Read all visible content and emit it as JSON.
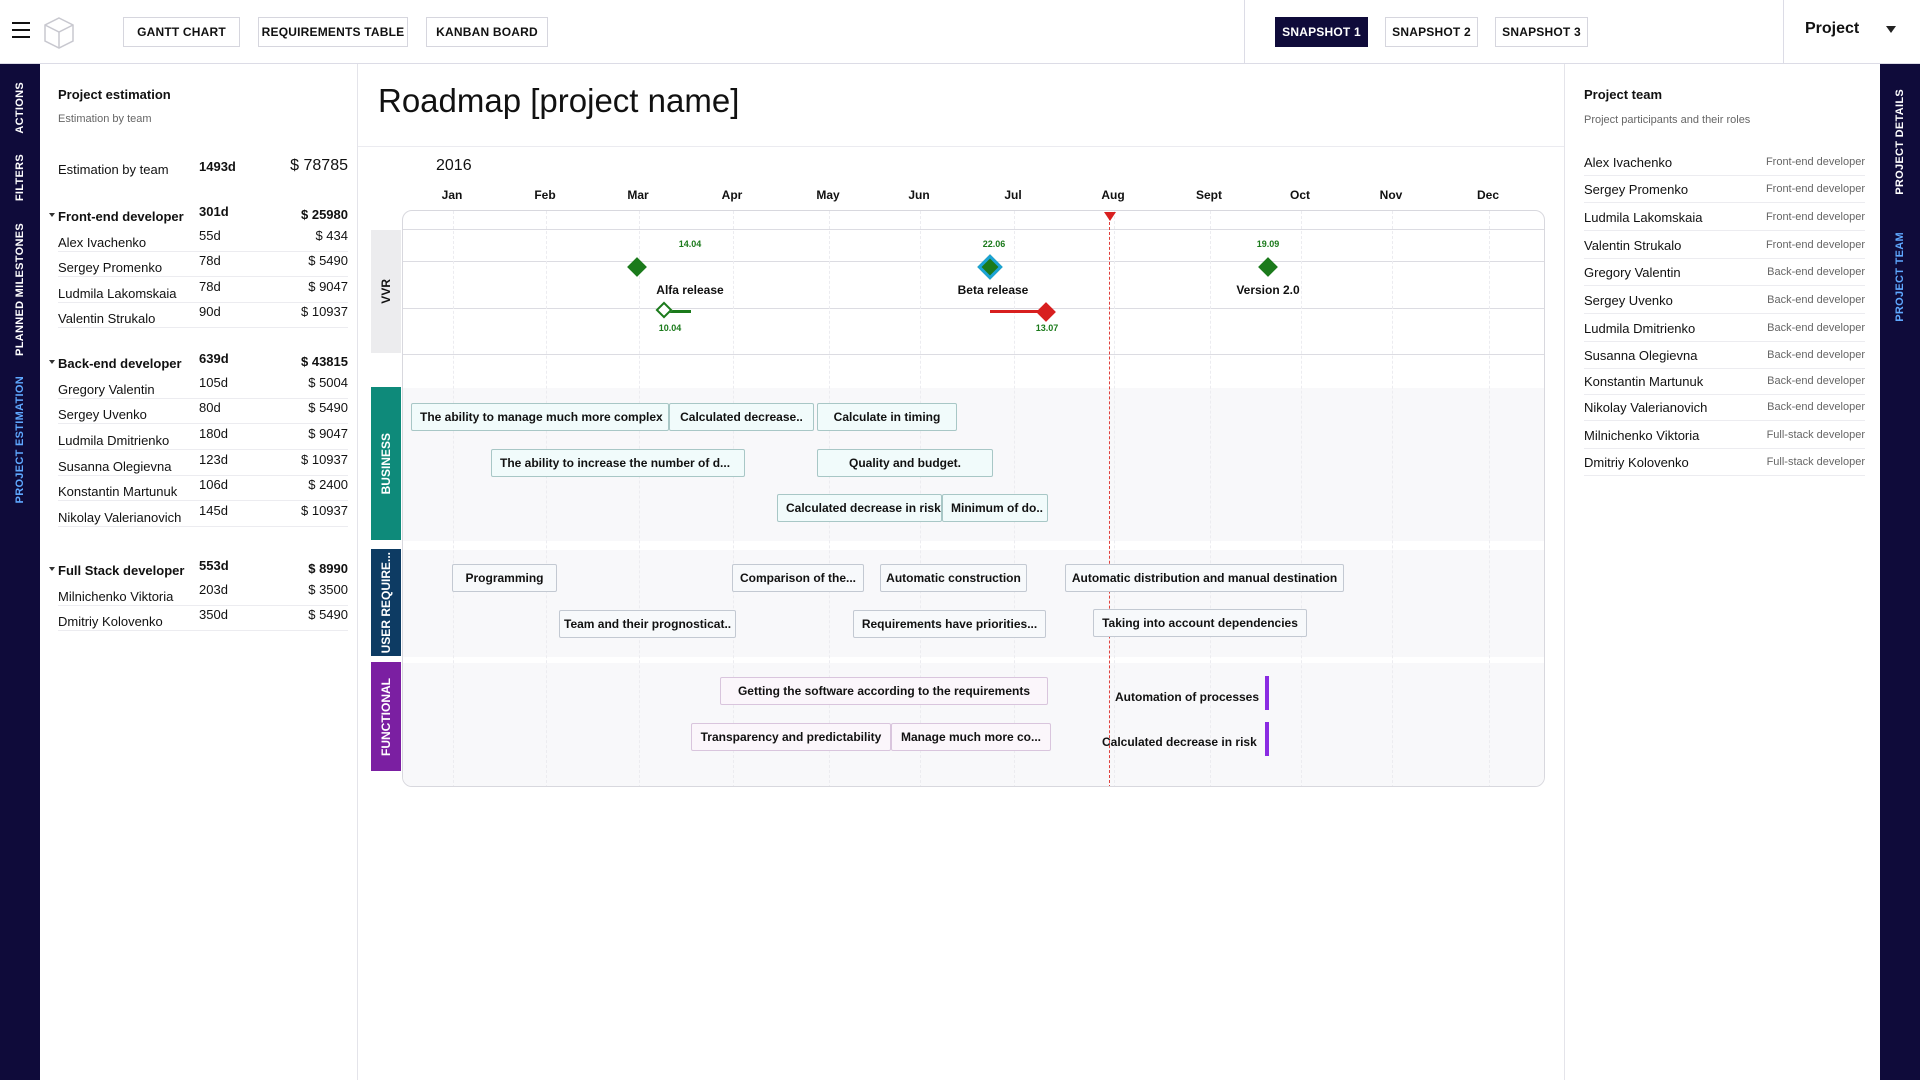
{
  "topbar": {
    "views": [
      "GANTT CHART",
      "REQUIREMENTS TABLE",
      "KANBAN BOARD"
    ],
    "snapshots": [
      "SNAPSHOT  1",
      "SNAPSHOT  2",
      "SNAPSHOT  3"
    ],
    "active_snapshot": 0,
    "project_select": "Project"
  },
  "left_rail": [
    "ACTIONS",
    "FILTERS",
    "PLANNED MILESTONES",
    "PROJECT ESTIMATION"
  ],
  "right_rail": [
    "PROJECT DETAILS",
    "PROJECT TEAM"
  ],
  "estimation": {
    "title": "Project estimation",
    "subtitle": "Estimation by team",
    "total": {
      "label": "Estimation by team",
      "days": "1493d",
      "cost": "$ 78785"
    },
    "groups": [
      {
        "role": "Front-end developer",
        "days": "301d",
        "cost": "$ 25980",
        "members": [
          {
            "name": "Alex Ivachenko",
            "days": "55d",
            "cost": "$ 434"
          },
          {
            "name": "Sergey Promenko",
            "days": "78d",
            "cost": "$ 5490"
          },
          {
            "name": "Ludmila Lakomskaia",
            "days": "78d",
            "cost": "$ 9047"
          },
          {
            "name": "Valentin Strukalo",
            "days": "90d",
            "cost": "$ 10937"
          }
        ]
      },
      {
        "role": "Back-end developer",
        "days": "639d",
        "cost": "$ 43815",
        "members": [
          {
            "name": "Gregory Valentin",
            "days": "105d",
            "cost": "$ 5004"
          },
          {
            "name": "Sergey Uvenko",
            "days": "80d",
            "cost": "$ 5490"
          },
          {
            "name": "Ludmila Dmitrienko",
            "days": "180d",
            "cost": "$ 9047"
          },
          {
            "name": "Susanna Olegievna",
            "days": "123d",
            "cost": "$ 10937"
          },
          {
            "name": "Konstantin Martunuk",
            "days": "106d",
            "cost": "$ 2400"
          },
          {
            "name": "Nikolay Valerianovich",
            "days": "145d",
            "cost": "$ 10937"
          }
        ]
      },
      {
        "role": "Full Stack developer",
        "days": "553d",
        "cost": "$ 8990",
        "members": [
          {
            "name": "Milnichenko Viktoria",
            "days": "203d",
            "cost": "$ 3500"
          },
          {
            "name": "Dmitriy Kolovenko",
            "days": "350d",
            "cost": "$ 5490"
          }
        ]
      }
    ]
  },
  "roadmap": {
    "title": "Roadmap [project name]",
    "year": "2016",
    "months": [
      "Jan",
      "Feb",
      "Mar",
      "Apr",
      "May",
      "Jun",
      "Jul",
      "Aug",
      "Sept",
      "Oct",
      "Nov",
      "Dec"
    ],
    "lanes": {
      "vvr": "VVR",
      "business": "BUSINESS",
      "user_req": "USER REQUIRE...",
      "functional": "FUNCTIONAL"
    },
    "milestones": [
      {
        "name": "Alfa release",
        "planned": "14.04",
        "actual": "10.04"
      },
      {
        "name": "Beta release",
        "planned": "22.06",
        "actual": "13.07"
      },
      {
        "name": "Version 2.0",
        "planned": "19.09"
      }
    ],
    "business_tasks": [
      "The ability to manage much more complex",
      "Calculated decrease..",
      "Calculate in timing",
      "The ability to increase the number of d...",
      "Quality and budget.",
      "Calculated decrease in risk",
      "Minimum of do.."
    ],
    "userreq_tasks": [
      "Programming",
      "Comparison of the...",
      "Automatic construction",
      "Automatic distribution and manual destination",
      "Team and their prognosticat..",
      "Requirements have priorities...",
      "Taking into account dependencies"
    ],
    "functional_tasks": [
      "Getting the software according to the requirements",
      "Automation of processes",
      "Transparency and predictability",
      "Manage much more co...",
      "Calculated decrease in risk"
    ],
    "colors": {
      "milestone_green": "#1b7a1b",
      "late_red": "#d81f1f",
      "business": "#0e8a7a",
      "user_req": "#0d3b63",
      "functional": "#7b1fa2"
    }
  },
  "team": {
    "title": "Project team",
    "subtitle": "Project participants and their roles",
    "members": [
      {
        "name": "Alex Ivachenko",
        "role": "Front-end developer"
      },
      {
        "name": "Sergey Promenko",
        "role": "Front-end developer"
      },
      {
        "name": "Ludmila Lakomskaia",
        "role": "Front-end developer"
      },
      {
        "name": "Valentin Strukalo",
        "role": "Front-end developer"
      },
      {
        "name": "Gregory Valentin",
        "role": "Back-end developer"
      },
      {
        "name": "Sergey Uvenko",
        "role": "Back-end developer"
      },
      {
        "name": "Ludmila Dmitrienko",
        "role": "Back-end developer"
      },
      {
        "name": "Susanna Olegievna",
        "role": "Back-end developer"
      },
      {
        "name": "Konstantin Martunuk",
        "role": "Back-end developer"
      },
      {
        "name": "Nikolay Valerianovich",
        "role": "Back-end developer"
      },
      {
        "name": "Milnichenko Viktoria",
        "role": "Full-stack developer"
      },
      {
        "name": "Dmitriy Kolovenko",
        "role": "Full-stack developer"
      }
    ]
  }
}
